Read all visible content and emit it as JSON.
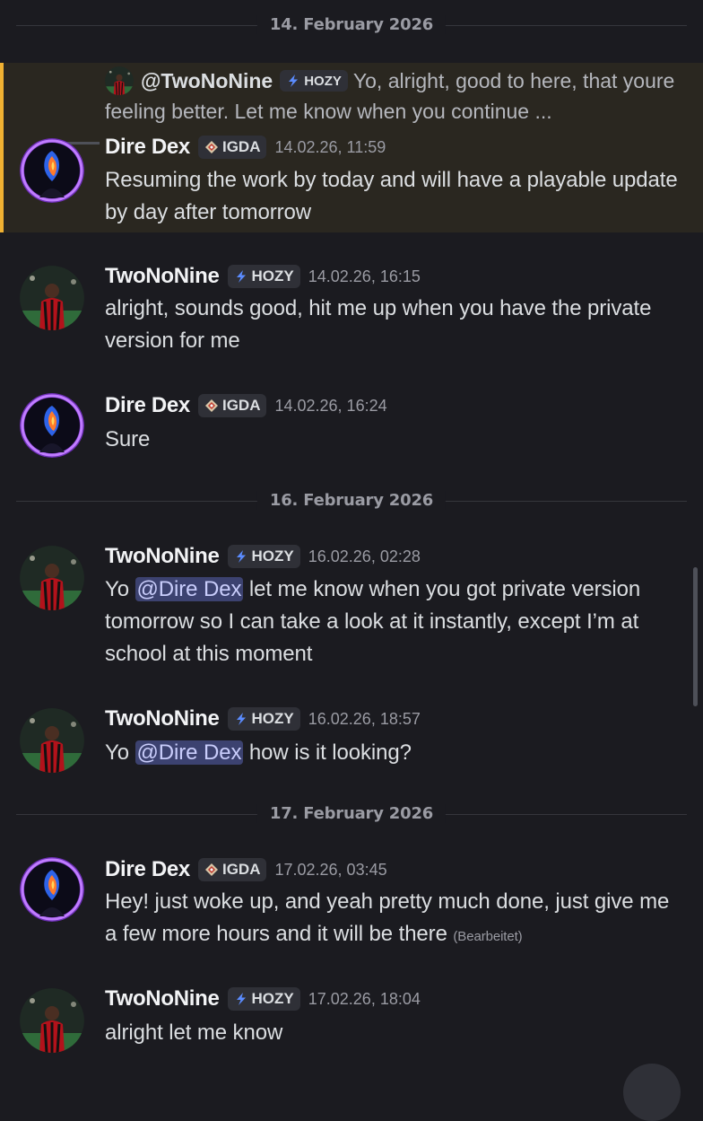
{
  "dividers": [
    {
      "label": "14. February 2026"
    },
    {
      "label": "16. February 2026"
    },
    {
      "label": "17. February 2026"
    }
  ],
  "reply": {
    "name": "@TwoNoNine",
    "tag": "HOZY",
    "text": "Yo, alright, good to here, that youre feeling better. Let me know when you continue ..."
  },
  "messages": [
    {
      "author": "Dire Dex",
      "tag": "IGDA",
      "time": "14.02.26, 11:59",
      "text": "Resuming the work by today and will have a playable update by day after tomorrow"
    },
    {
      "author": "TwoNoNine",
      "tag": "HOZY",
      "time": "14.02.26, 16:15",
      "text": "alright, sounds good, hit me up when you have the private version for me"
    },
    {
      "author": "Dire Dex",
      "tag": "IGDA",
      "time": "14.02.26, 16:24",
      "text": "Sure"
    },
    {
      "author": "TwoNoNine",
      "tag": "HOZY",
      "time": "16.02.26, 02:28",
      "pre": "Yo ",
      "mention": "@Dire Dex",
      "text": " let me know when you got private version tomorrow so I can take a look at it instantly, except I’m at school at this moment"
    },
    {
      "author": "TwoNoNine",
      "tag": "HOZY",
      "time": "16.02.26, 18:57",
      "pre": "Yo ",
      "mention": "@Dire Dex",
      "text": " how is it looking?"
    },
    {
      "author": "Dire Dex",
      "tag": "IGDA",
      "time": "17.02.26, 03:45",
      "text": "Hey! just woke up, and yeah pretty much done, just give me a few more hours and it will be there",
      "edited": "(Bearbeitet)"
    },
    {
      "author": "TwoNoNine",
      "tag": "HOZY",
      "time": "17.02.26, 18:04",
      "text": "alright let me know"
    }
  ],
  "colors": {
    "background": "#1b1b20",
    "highlight": "#2a2720",
    "highlight_bar": "#f0b132",
    "mention_bg": "#3c4270"
  },
  "icons": [
    "igda-diamond-icon",
    "hozy-bolt-icon",
    "dire-dex-avatar",
    "twononine-avatar"
  ]
}
